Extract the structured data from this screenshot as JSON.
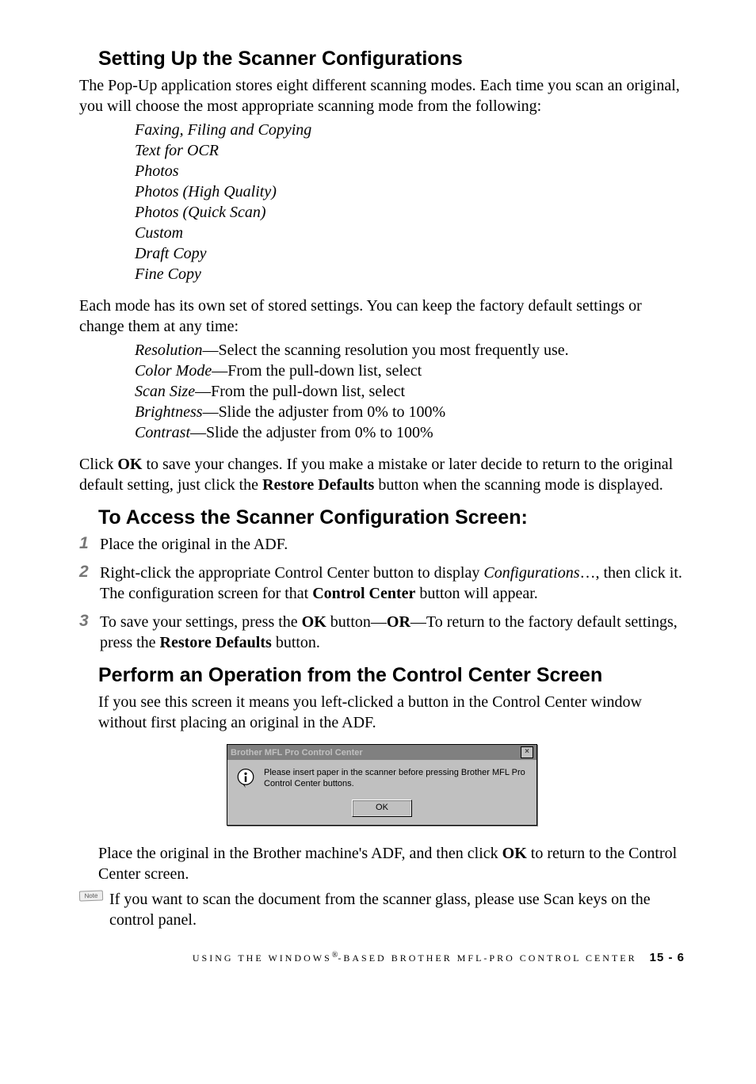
{
  "sections": {
    "s1": {
      "heading": "Setting Up the Scanner Configurations",
      "p1": "The Pop-Up application stores eight different scanning modes. Each time you scan an original, you will choose the most appropriate scanning mode from the following:",
      "modes": [
        "Faxing, Filing and Copying",
        "Text for OCR",
        "Photos",
        "Photos (High Quality)",
        "Photos (Quick Scan)",
        "Custom",
        "Draft Copy",
        "Fine Copy"
      ],
      "p2": "Each mode has its own set of stored settings. You can keep the factory default settings or change them at any time:",
      "settings": [
        {
          "key": "Resolution",
          "desc": "—Select the scanning resolution you most frequently use."
        },
        {
          "key": "Color Mode",
          "desc": "—From the pull-down list, select"
        },
        {
          "key": "Scan Size",
          "desc": "—From the pull-down list, select"
        },
        {
          "key": "Brightness",
          "desc": "—Slide the adjuster from 0% to 100%"
        },
        {
          "key": "Contrast",
          "desc": "—Slide the adjuster from 0% to 100%"
        }
      ],
      "p3_pre": "Click ",
      "p3_ok": "OK",
      "p3_mid": " to save your changes. If you make a mistake or later decide to return to the original default setting, just click the ",
      "p3_restore": "Restore Defaults",
      "p3_post": " button when the scanning mode is displayed."
    },
    "s2": {
      "heading": "To Access the Scanner Configuration Screen:",
      "steps": {
        "n1": "1",
        "t1": "Place the original in the ADF.",
        "n2": "2",
        "t2_a": "Right-click the appropriate Control Center button to display ",
        "t2_i": "Configurations",
        "t2_b": "…, then click it. The configuration screen for that ",
        "t2_bold": "Control Center",
        "t2_c": " button will appear.",
        "n3": "3",
        "t3_a": "To save your settings, press the ",
        "t3_ok": "OK",
        "t3_b": " button—",
        "t3_or": "OR",
        "t3_c": "—To return to the factory default settings, press the ",
        "t3_restore": "Restore Defaults",
        "t3_d": " button."
      }
    },
    "s3": {
      "heading": "Perform an Operation from the Control Center Screen",
      "p1": "If you see this screen it means you left-clicked a button in the Control Center window without first placing an original in the ADF.",
      "dialog": {
        "title": "Brother MFL Pro Control Center",
        "close": "×",
        "message": "Please insert paper in the scanner before pressing Brother MFL Pro Control Center buttons.",
        "ok": "OK"
      },
      "p2_a": "Place the original in the Brother machine's ADF, and then click ",
      "p2_ok": "OK",
      "p2_b": " to return to the Control Center screen.",
      "note_label": "Note",
      "note": "If you want to scan the document from the scanner glass, please use Scan keys on the control panel."
    }
  },
  "footer": {
    "title_a": "USING THE WINDOWS",
    "reg": "®",
    "title_b": "-BASED BROTHER MFL-PRO CONTROL CENTER",
    "page": "15 - 6"
  }
}
